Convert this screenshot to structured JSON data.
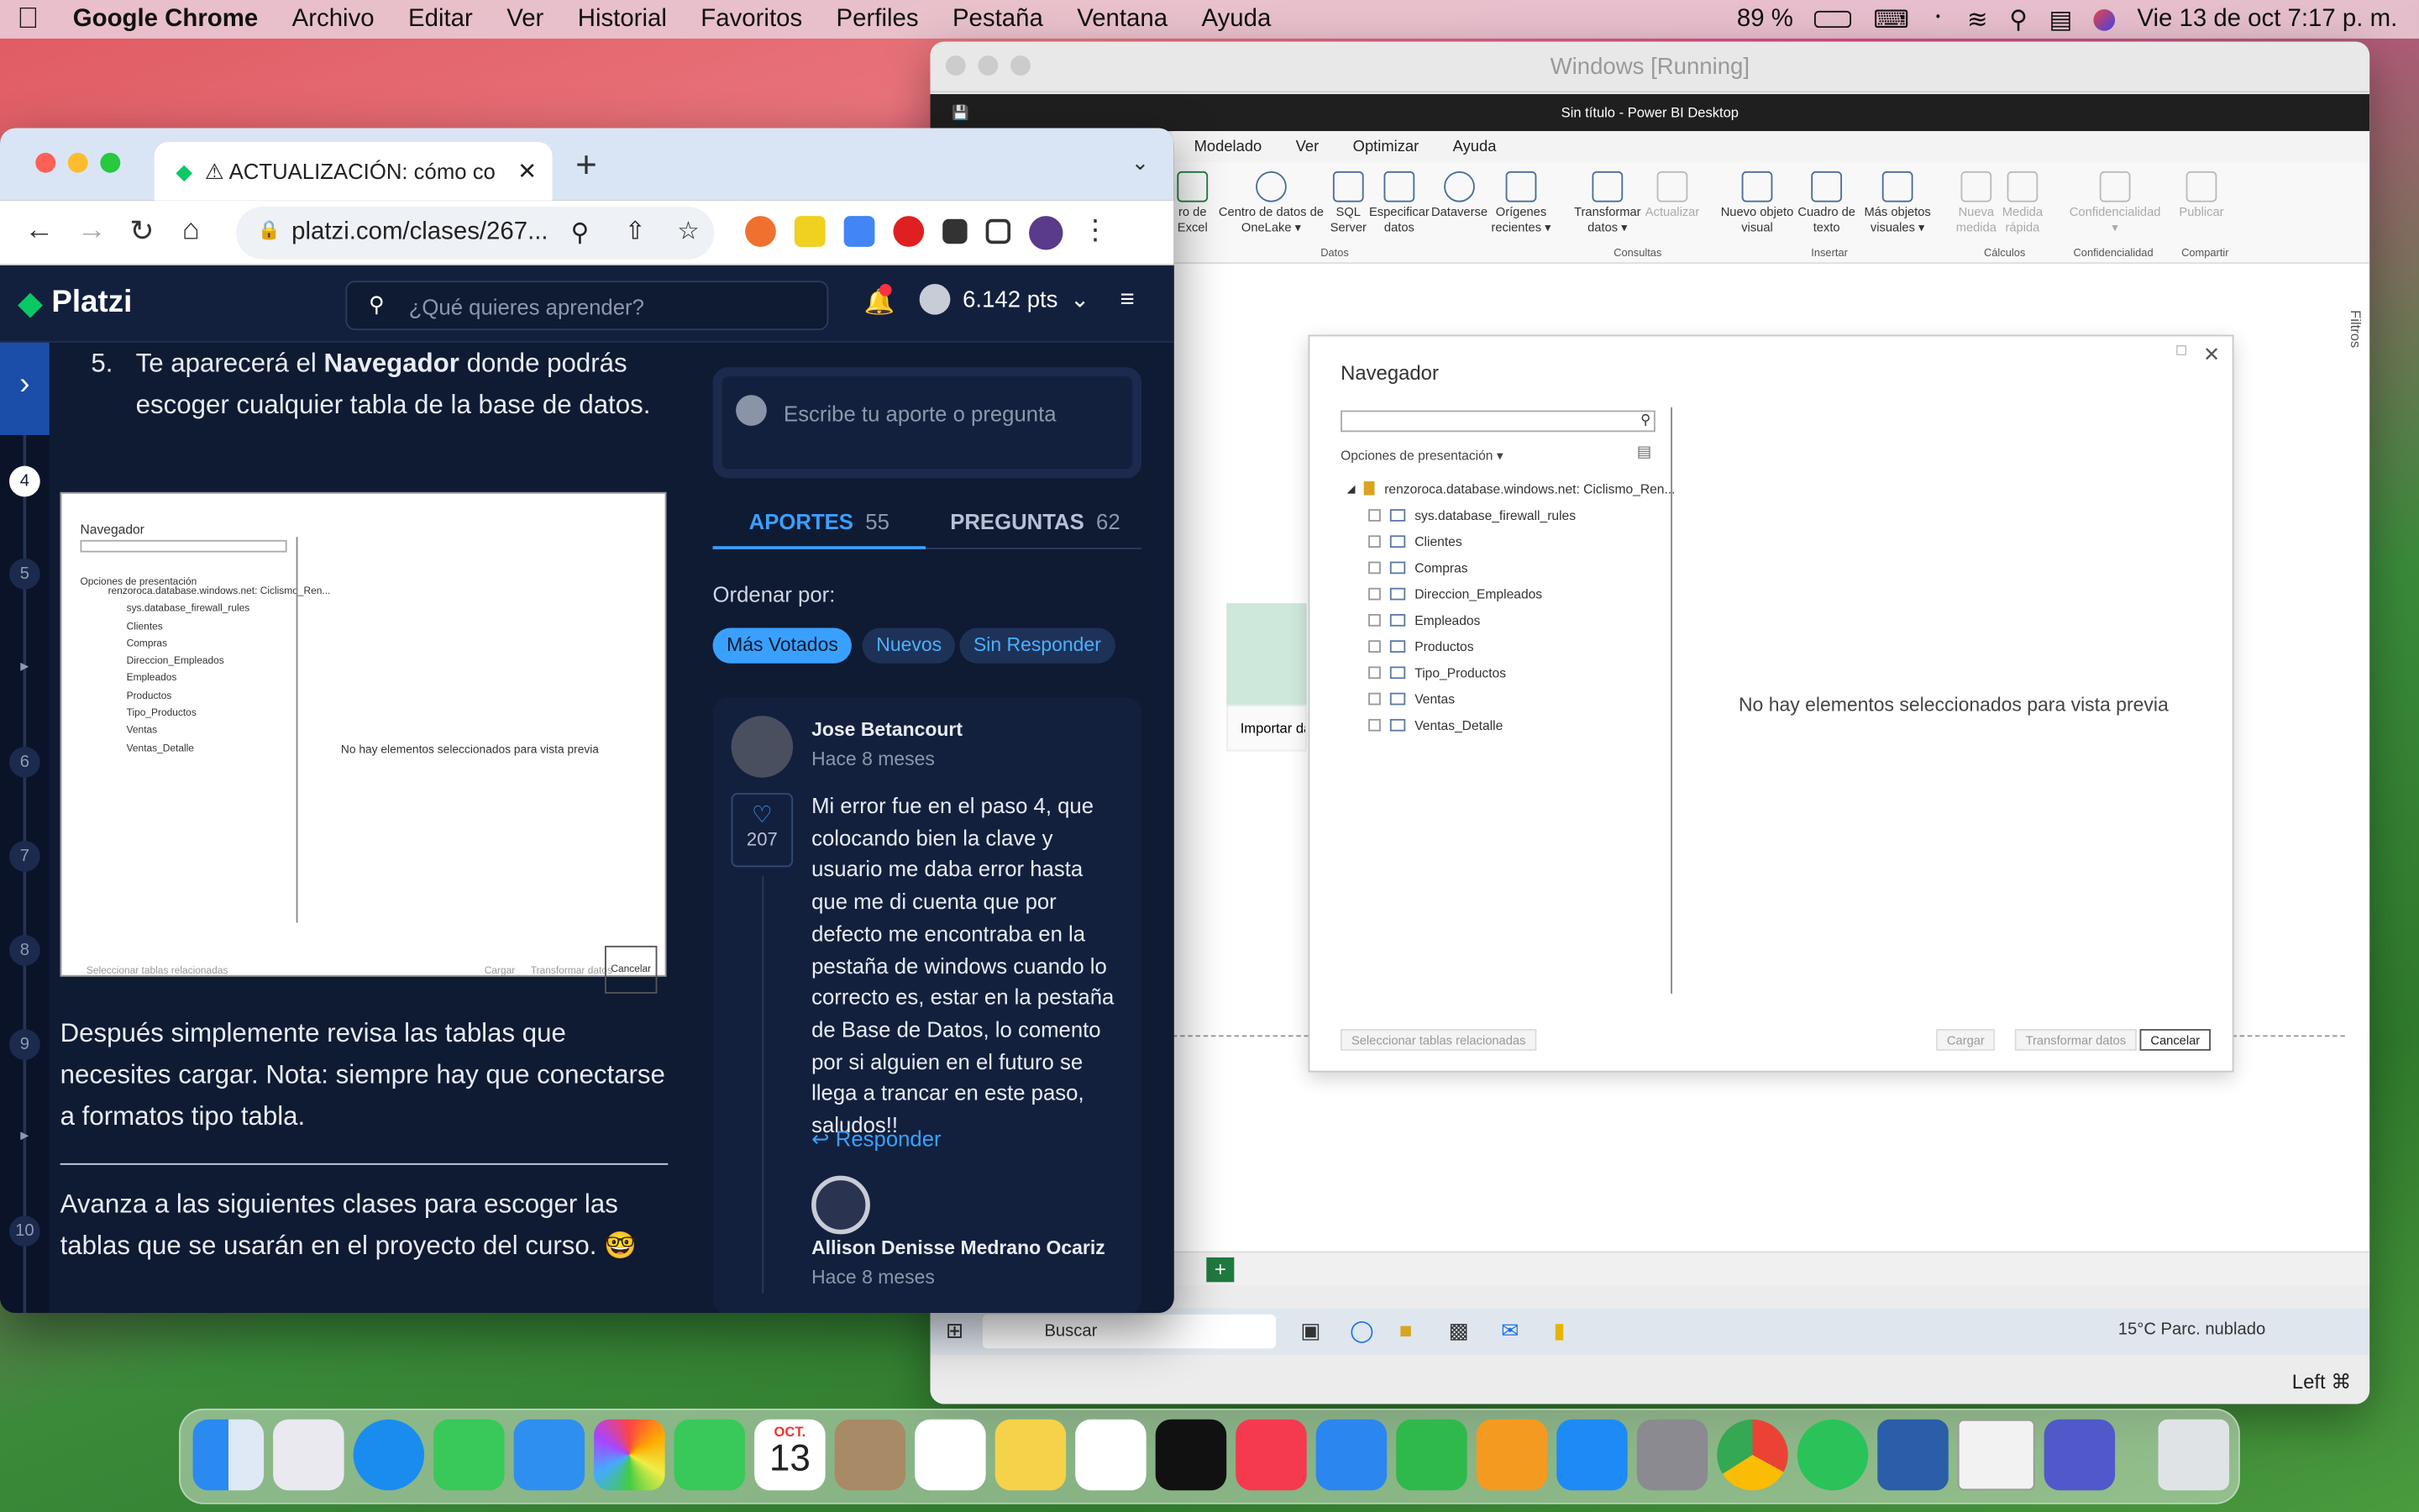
{
  "menubar": {
    "app": "Google Chrome",
    "items": [
      "Archivo",
      "Editar",
      "Ver",
      "Historial",
      "Favoritos",
      "Perfiles",
      "Pestaña",
      "Ventana",
      "Ayuda"
    ],
    "battery": "89 %",
    "datetime": "Vie 13 de oct  7:17 p. m."
  },
  "vm": {
    "title": "Windows [Running]",
    "pbi_title": "Sin título - Power BI Desktop",
    "pbi_tabs": [
      "Modelado",
      "Ver",
      "Optimizar",
      "Ayuda"
    ],
    "ribbon": [
      {
        "label": "ro de\nExcel"
      },
      {
        "label": "Centro de datos de\nOneLake ▾"
      },
      {
        "label": "SQL\nServer"
      },
      {
        "label": "Especificar\ndatos"
      },
      {
        "label": "Dataverse"
      },
      {
        "label": "Orígenes\nrecientes ▾"
      },
      {
        "label": "Transformar\ndatos ▾"
      },
      {
        "label": "Actualizar"
      },
      {
        "label": "Nuevo objeto\nvisual"
      },
      {
        "label": "Cuadro de\ntexto"
      },
      {
        "label": "Más objetos\nvisuales ▾"
      },
      {
        "label": "Nueva\nmedida"
      },
      {
        "label": "Medida\nrápida"
      },
      {
        "label": "Confidencialidad\n▾"
      },
      {
        "label": "Publicar"
      }
    ],
    "ribbon_groups": [
      "Datos",
      "Consultas",
      "Insertar",
      "Cálculos",
      "Confidencialidad",
      "Compartir"
    ],
    "import_label": "Importar da",
    "taskbar_search": "Buscar",
    "weather": "15°C  Parc. nublado",
    "status_right": "Left ⌘"
  },
  "navigator": {
    "title": "Navegador",
    "options_label": "Opciones de presentación",
    "server": "renzoroca.database.windows.net: Ciclismo_Ren...",
    "tables": [
      "sys.database_firewall_rules",
      "Clientes",
      "Compras",
      "Direccion_Empleados",
      "Empleados",
      "Productos",
      "Tipo_Productos",
      "Ventas",
      "Ventas_Detalle"
    ],
    "empty_message": "No hay elementos seleccionados para vista previa",
    "select_related": "Seleccionar tablas relacionadas",
    "load": "Cargar",
    "transform": "Transformar datos",
    "cancel": "Cancelar"
  },
  "chrome": {
    "tab_title": "⚠ ACTUALIZACIÓN: cómo co",
    "url": "platzi.com/clases/267..."
  },
  "platzi": {
    "brand": "Platzi",
    "search_placeholder": "¿Qué quieres aprender?",
    "points": "6.142 pts",
    "rail_numbers": [
      "4",
      "5",
      "6",
      "7",
      "8",
      "9",
      "10"
    ],
    "step_number": "5.",
    "step_text_a": "Te aparecerá el ",
    "step_bold": "Navegador",
    "step_text_b": " donde podrás escoger cualquier tabla de la base de datos.",
    "paragraph1": "Después simplemente revisa las tablas que necesites cargar. Nota: siempre hay que conectarse a formatos tipo tabla.",
    "paragraph2": "Avanza a las siguientes clases para escoger las tablas que se usarán en el proyecto del curso. 🤓",
    "aporte_placeholder": "Escribe tu aporte o pregunta",
    "tab_aportes": "APORTES",
    "tab_aportes_count": "55",
    "tab_preguntas": "PREGUNTAS",
    "tab_preguntas_count": "62",
    "order_label": "Ordenar por:",
    "filters": [
      "Más Votados",
      "Nuevos",
      "Sin Responder"
    ],
    "comment": {
      "author": "Jose Betancourt",
      "time": "Hace 8 meses",
      "likes": "207",
      "text": "Mi error fue en el paso 4, que colocando bien la clave y usuario me daba error hasta que me di cuenta que por defecto me encontraba en la pestaña de windows cuando lo correcto es, estar en la pestaña de Base de Datos, lo comento por si alguien en el futuro se llega a trancar en este paso, saludos!!",
      "reply": "Responder"
    },
    "reply": {
      "author": "Allison Denisse Medrano Ocariz",
      "time": "Hace 8 meses"
    }
  },
  "dock": {
    "calendar_month": "OCT.",
    "calendar_day": "13"
  }
}
